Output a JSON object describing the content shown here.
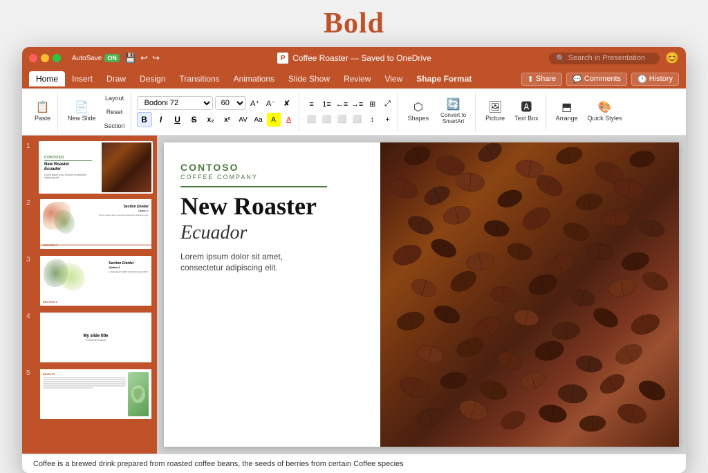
{
  "page": {
    "title": "Bold"
  },
  "titlebar": {
    "autosave_label": "AutoSave",
    "autosave_status": "ON",
    "doc_title": "Coffee Roaster — Saved to OneDrive",
    "search_placeholder": "Search in Presentation",
    "close_label": "×",
    "min_label": "−",
    "max_label": "+"
  },
  "ribbon": {
    "tabs": [
      {
        "label": "Home",
        "active": true
      },
      {
        "label": "Insert",
        "active": false
      },
      {
        "label": "Draw",
        "active": false
      },
      {
        "label": "Design",
        "active": false
      },
      {
        "label": "Transitions",
        "active": false
      },
      {
        "label": "Animations",
        "active": false
      },
      {
        "label": "Slide Show",
        "active": false
      },
      {
        "label": "Review",
        "active": false
      },
      {
        "label": "View",
        "active": false
      },
      {
        "label": "Shape Format",
        "active": false
      }
    ],
    "share_label": "Share",
    "comments_label": "Comments",
    "history_label": "History"
  },
  "toolbar": {
    "paste_label": "Paste",
    "new_slide_label": "New Slide",
    "layout_label": "Layout",
    "reset_label": "Reset",
    "section_label": "Section",
    "font_name": "Bodoni 72",
    "font_size": "60",
    "bold": "B",
    "italic": "I",
    "underline": "U",
    "strikethrough": "S",
    "subscript": "x₂",
    "superscript": "x²",
    "font_color": "A",
    "text_highlight": "A",
    "shapes_label": "Shapes",
    "picture_label": "Picture",
    "textbox_label": "Text Box",
    "arrange_label": "Arrange",
    "quick_styles_label": "Quick Styles",
    "convert_smartart": "Convert to SmartArt"
  },
  "slides": [
    {
      "number": "1",
      "title": "New Roaster Ecuador",
      "selected": true
    },
    {
      "number": "2",
      "title": "Section Divider Option 1",
      "selected": false
    },
    {
      "number": "3",
      "title": "Section Divider Option 2",
      "selected": false
    },
    {
      "number": "4",
      "title": "My slide title",
      "selected": false
    },
    {
      "number": "5",
      "title": "About Us",
      "selected": false
    }
  ],
  "main_slide": {
    "company": "CONTOSO",
    "company_sub": "COFFEE COMPANY",
    "title": "New Roaster",
    "subtitle": "Ecuador",
    "body": "Lorem ipsum dolor sit amet,\nconsectetur adipiscing elit."
  },
  "bottom_bar": {
    "text": "Coffee is a brewed drink prepared from roasted coffee beans, the seeds of berries from certain Coffee species"
  }
}
